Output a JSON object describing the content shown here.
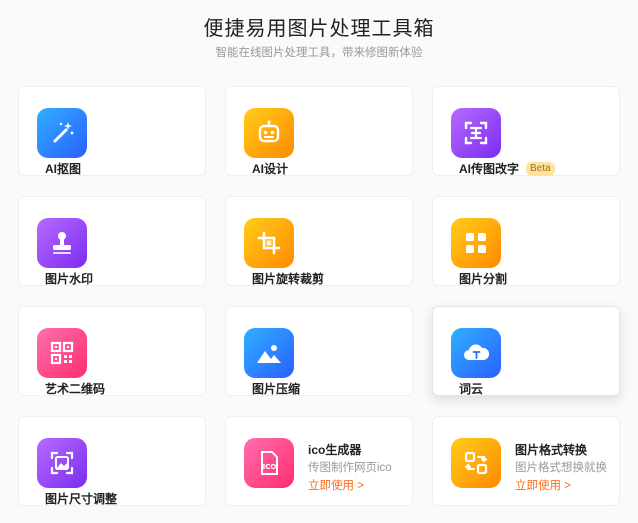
{
  "header": {
    "title": "便捷易用图片处理工具箱",
    "subtitle": "智能在线图片处理工具，带来修图新体验"
  },
  "tools": [
    {
      "label": "AI抠图",
      "icon": "magic-wand-icon",
      "gradient": [
        "#2fb0ff",
        "#2b5fff"
      ]
    },
    {
      "label": "AI设计",
      "icon": "robot-icon",
      "gradient": [
        "#ffcc1a",
        "#ff8a00"
      ]
    },
    {
      "label": "AI传图改字",
      "icon": "text-scan-icon",
      "gradient": [
        "#b66bff",
        "#7c2cf0"
      ],
      "badge": "Beta"
    },
    {
      "label": "图片水印",
      "icon": "stamp-icon",
      "gradient": [
        "#b66bff",
        "#7c2cf0"
      ]
    },
    {
      "label": "图片旋转裁剪",
      "icon": "crop-rotate-icon",
      "gradient": [
        "#ffcc1a",
        "#ff8a00"
      ]
    },
    {
      "label": "图片分割",
      "icon": "grid-split-icon",
      "gradient": [
        "#ffcc1a",
        "#ff8a00"
      ]
    },
    {
      "label": "艺术二维码",
      "icon": "qrcode-icon",
      "gradient": [
        "#ff6fae",
        "#ff2d6e"
      ]
    },
    {
      "label": "图片压缩",
      "icon": "image-compress-icon",
      "gradient": [
        "#2fb0ff",
        "#2b5fff"
      ]
    },
    {
      "label": "词云",
      "icon": "word-cloud-icon",
      "gradient": [
        "#2fb0ff",
        "#2b5fff"
      ]
    },
    {
      "label": "图片尺寸调整",
      "icon": "image-resize-icon",
      "gradient": [
        "#b66bff",
        "#7c2cf0"
      ]
    }
  ],
  "featured": [
    {
      "title": "ico生成器",
      "desc": "传图制作网页ico",
      "link": "立即使用 >",
      "icon": "ico-file-icon",
      "icon_text": "ICO",
      "gradient": [
        "#ff6fae",
        "#ff2d6e"
      ]
    },
    {
      "title": "图片格式转换",
      "desc": "图片格式想换就换",
      "link": "立即使用 >",
      "icon": "format-convert-icon",
      "gradient": [
        "#ffcc1a",
        "#ff8a00"
      ]
    }
  ]
}
